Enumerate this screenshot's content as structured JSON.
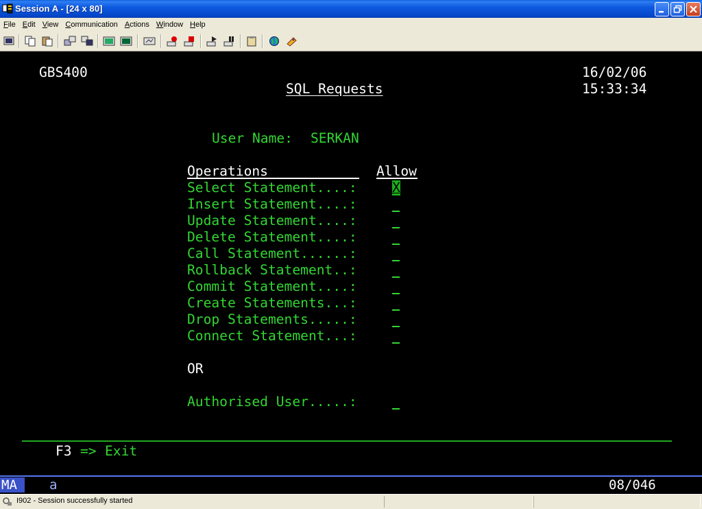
{
  "window": {
    "title": "Session A - [24 x 80]"
  },
  "menu": {
    "items": [
      {
        "label": "File",
        "accel": "F",
        "rest": "ile"
      },
      {
        "label": "Edit",
        "accel": "E",
        "rest": "dit"
      },
      {
        "label": "View",
        "accel": "V",
        "rest": "iew"
      },
      {
        "label": "Communication",
        "accel": "C",
        "rest": "ommunication"
      },
      {
        "label": "Actions",
        "accel": "A",
        "rest": "ctions"
      },
      {
        "label": "Window",
        "accel": "W",
        "rest": "indow"
      },
      {
        "label": "Help",
        "accel": "H",
        "rest": "elp"
      }
    ]
  },
  "toolbar": {
    "icons": [
      "print-screen-icon",
      "copy-icon",
      "paste-icon",
      "send-icon",
      "receive-icon",
      "display-icon",
      "keypad-icon",
      "macro-icon",
      "record-macro-icon",
      "stop-macro-icon",
      "play-macro-icon",
      "pause-macro-icon",
      "clipboard-icon",
      "globe-icon",
      "help-icon"
    ]
  },
  "screen": {
    "system": "GBS400",
    "date": "16/02/06",
    "time": "15:33:34",
    "title": "SQL Requests",
    "user_label": "User Name:",
    "user_value": "SERKAN",
    "ops_header": "Operations",
    "allow_header": "Allow",
    "operations": [
      {
        "label": "Select Statement....:",
        "value": "X"
      },
      {
        "label": "Insert Statement....:",
        "value": ""
      },
      {
        "label": "Update Statement....:",
        "value": ""
      },
      {
        "label": "Delete Statement....:",
        "value": ""
      },
      {
        "label": "Call Statement......:",
        "value": ""
      },
      {
        "label": "Rollback Statement..:",
        "value": ""
      },
      {
        "label": "Commit Statement....:",
        "value": ""
      },
      {
        "label": "Create Statements...:",
        "value": ""
      },
      {
        "label": "Drop Statements.....:",
        "value": ""
      },
      {
        "label": "Connect Statement...:",
        "value": ""
      }
    ],
    "or_text": "OR",
    "auth_label": "Authorised User.....:",
    "auth_value": "",
    "f3_key": "F3",
    "f3_arrow": "=>",
    "f3_action": "Exit"
  },
  "oia": {
    "mode": "MA",
    "indicator": "a",
    "cursor_pos": "08/046"
  },
  "status": {
    "text": "I902 - Session successfully started"
  },
  "colors": {
    "field_green": "#33d633",
    "title_blue": "#0a5fd8",
    "oia_blue": "#3a52c8"
  }
}
